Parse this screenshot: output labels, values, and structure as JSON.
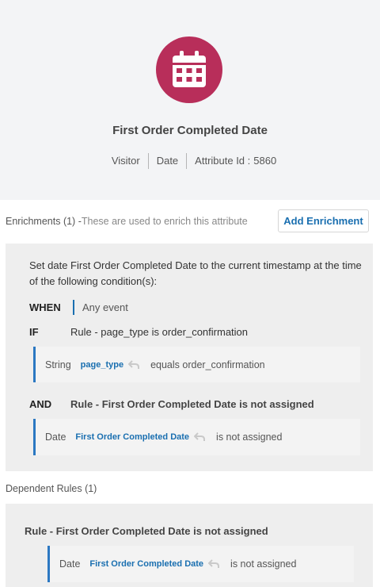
{
  "attribute": {
    "title": "First Order Completed Date",
    "meta": {
      "scope": "Visitor",
      "type": "Date",
      "attr_label": "Attribute Id :",
      "attr_id": "5860"
    },
    "icon": "calendar-icon",
    "accent_color": "#b82e5a"
  },
  "enrichments": {
    "label": "Enrichments (1) -",
    "desc": "These are used to enrich this attribute",
    "add_button": "Add Enrichment",
    "item": {
      "statement": "Set date First Order Completed Date to the current timestamp at the time of the following condition(s):",
      "when": {
        "keyword": "WHEN",
        "value": "Any event"
      },
      "if": {
        "keyword": "IF",
        "rule": "Rule - page_type is order_confirmation",
        "condition": {
          "type": "String",
          "token": "page_type",
          "op": "equals order_confirmation"
        }
      },
      "and": {
        "keyword": "AND",
        "rule": "Rule - First Order Completed Date is not assigned",
        "condition": {
          "type": "Date",
          "token": "First Order Completed Date",
          "op": "is not assigned"
        }
      }
    }
  },
  "dependent": {
    "label": "Dependent Rules (1)",
    "rule": "Rule - First Order Completed Date is not assigned",
    "condition": {
      "type": "Date",
      "token": "First Order Completed Date",
      "op": "is not assigned"
    }
  }
}
